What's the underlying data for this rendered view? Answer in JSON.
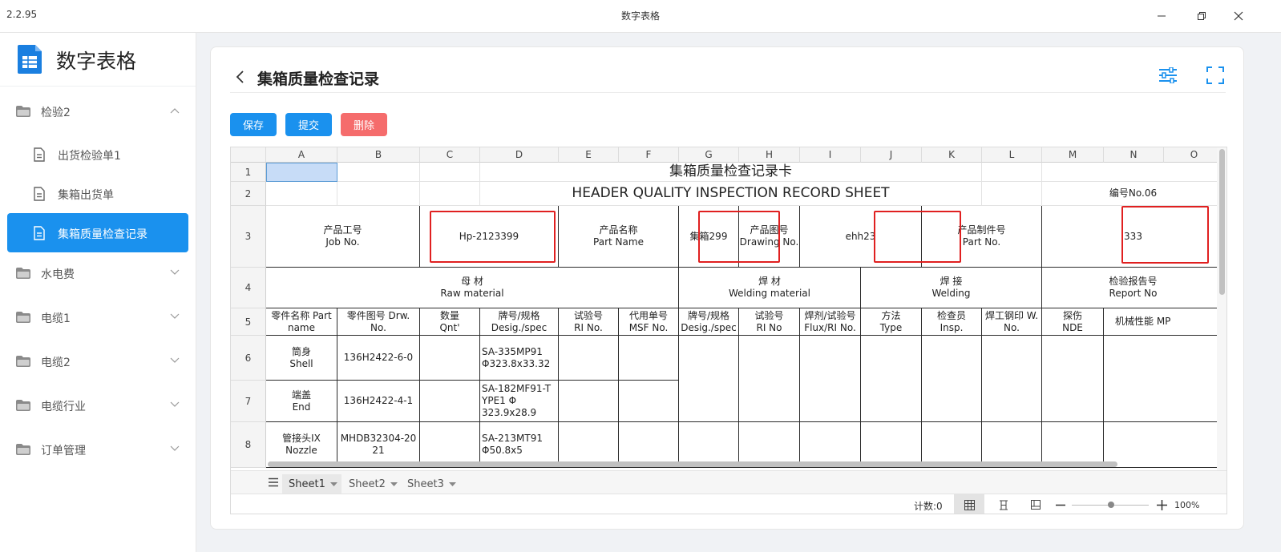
{
  "window": {
    "version": "2.2.95",
    "title": "数字表格"
  },
  "brand": {
    "name": "数字表格"
  },
  "sidebar": {
    "groups": [
      {
        "label": "检验2",
        "expanded": true
      },
      {
        "label": "水电费",
        "expanded": false
      },
      {
        "label": "电缆1",
        "expanded": false
      },
      {
        "label": "电缆2",
        "expanded": false
      },
      {
        "label": "电缆行业",
        "expanded": false
      },
      {
        "label": "订单管理",
        "expanded": false
      }
    ],
    "sub_items": [
      {
        "label": "出货检验单1"
      },
      {
        "label": "集箱出货单"
      },
      {
        "label": "集箱质量检查记录",
        "active": true
      }
    ]
  },
  "page": {
    "title": "集箱质量检查记录"
  },
  "toolbar": {
    "save": "保存",
    "submit": "提交",
    "delete": "删除"
  },
  "colors": {
    "accent": "#1a91ee",
    "danger": "#f56c6c",
    "highlight_box": "#e02020"
  },
  "sheet": {
    "columns": [
      "A",
      "B",
      "C",
      "D",
      "E",
      "F",
      "G",
      "H",
      "I",
      "J",
      "K",
      "L",
      "M",
      "N",
      "O"
    ],
    "rows": [
      "1",
      "2",
      "3",
      "4",
      "5",
      "6",
      "7",
      "8"
    ],
    "title_cn": "集箱质量检查记录卡",
    "title_en": "HEADER QUALITY INSPECTION RECORD SHEET",
    "number_no": "编号No.06",
    "job_no_label": "产品工号\nJob  No.",
    "job_no_value": "Hp-2123399",
    "part_name_label": "产品名称\nPart Name",
    "part_name_value": "集箱299",
    "drawing_no_label": "产品图号\nDrawing No.",
    "drawing_no_value": "ehh23",
    "part_no_label": "产品制件号\nPart No.",
    "part_no_value": "333",
    "raw_material": "母          材\nRaw   material",
    "welding_material": "焊          材\nWelding  material",
    "welding": "焊       接\nWelding",
    "report_no": "检验报告号\nReport No",
    "headers": [
      "零件名称 Part\nname",
      "零件图号  Drw.\nNo.",
      "数量\nQnt'",
      "牌号/规格\nDesig./spec",
      "试验号\n                RI No.",
      "代用单号\nMSF No.",
      "牌号/规格\nDesig./spec",
      "试验号\n               RI No",
      "焊剂/试验号\nFlux/RI No.",
      "方法\n       Type",
      "检查员\n       Insp.",
      "焊工钢印 W.\nNo.",
      "探伤\n    NDE",
      "机械性能                  MP"
    ],
    "body_rows": [
      {
        "name": "筒身\nShell",
        "drw": "136H2422-6-0",
        "spec": "SA-335MP91\n Φ323.8x33.32"
      },
      {
        "name": "端盖\nEnd",
        "drw": "136H2422-4-1",
        "spec": "SA-182MF91-T\nYPE1              Φ\n      323.9x28.9"
      },
      {
        "name": "管接头IX\nNozzle",
        "drw": "MHDB32304-20\n21",
        "spec": "SA-213MT91\n     Φ50.8x5"
      }
    ],
    "tabs": [
      "Sheet1",
      "Sheet2",
      "Sheet3"
    ],
    "active_tab": "Sheet1",
    "status_count": "计数:0",
    "zoom": "100%"
  }
}
